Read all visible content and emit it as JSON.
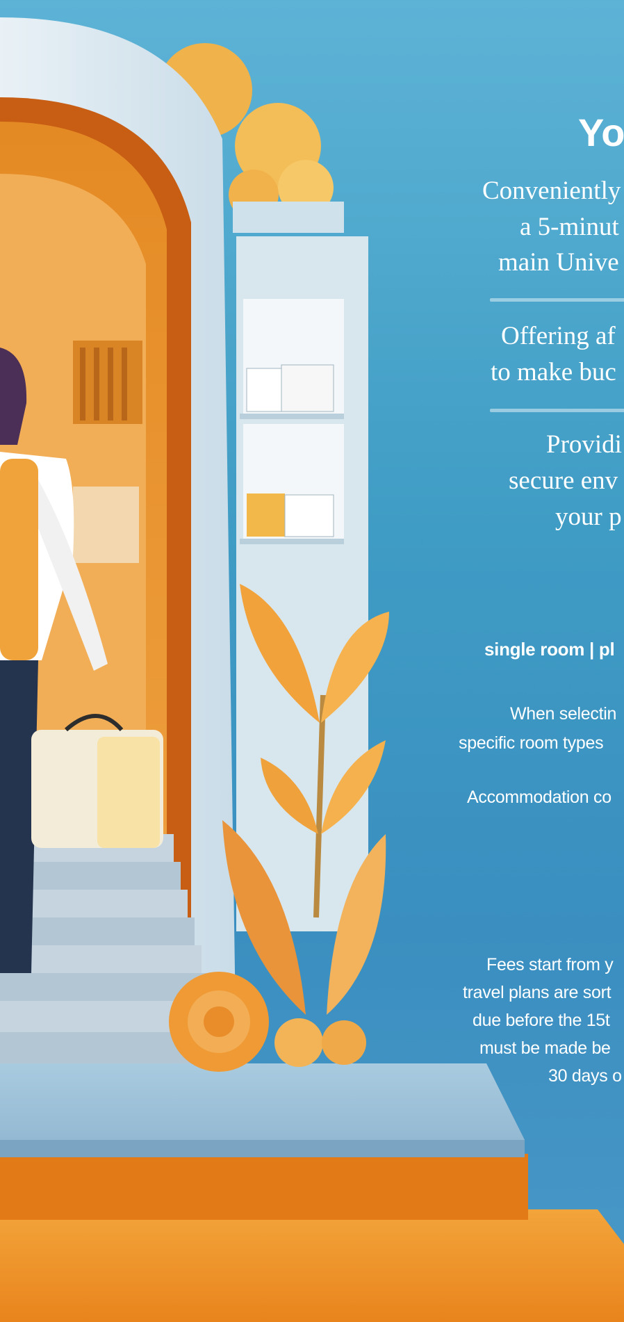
{
  "title": "Yo",
  "location_lines": [
    "Conveniently",
    "a 5-minut",
    "main Unive"
  ],
  "price_lines": [
    "Offering af",
    "to make buc"
  ],
  "security_lines": [
    "Providi",
    "secure env",
    "your p"
  ],
  "room_types": "single room | pl",
  "selection_lines": [
    "When selectin",
    "specific room types"
  ],
  "cost_line": "Accommodation co",
  "fees_lines": [
    "Fees start from y",
    "travel plans are sort",
    "due before the 15t",
    "must be made be",
    "30 days o"
  ],
  "colors": {
    "sky": "#4aa3cc",
    "orange": "#e98b1e",
    "white": "#ffffff"
  }
}
